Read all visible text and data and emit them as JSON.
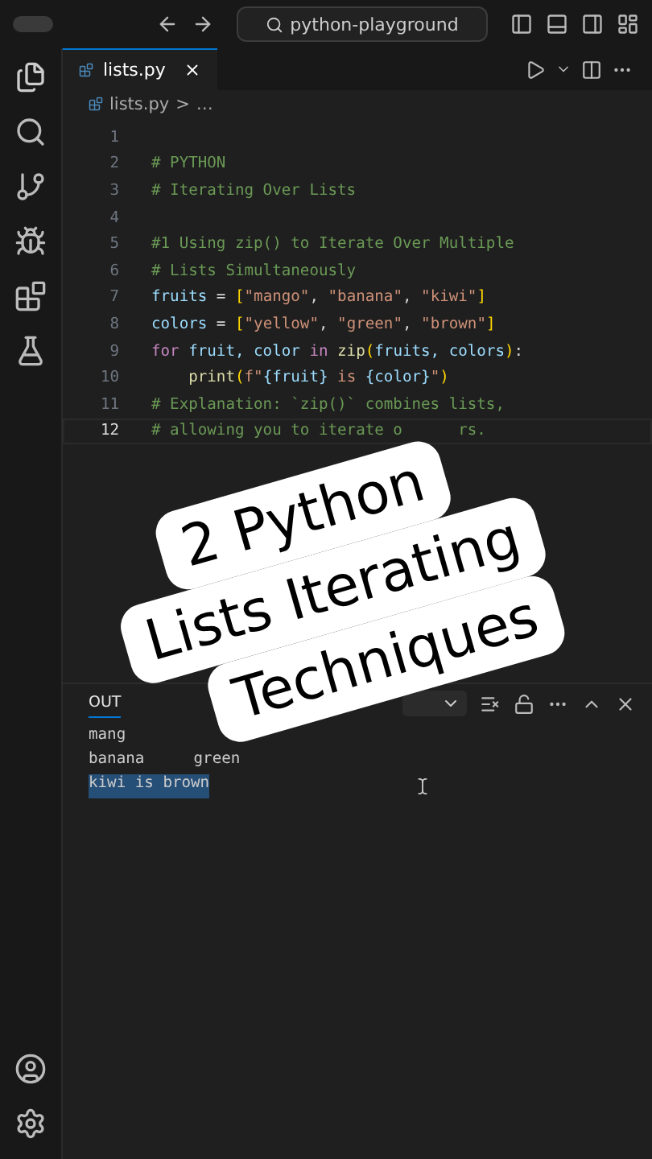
{
  "title_bar": {
    "search": "python-playground"
  },
  "tabs": [
    {
      "label": "lists.py",
      "selected": true
    }
  ],
  "breadcrumb": [
    "lists.py",
    ">",
    "…"
  ],
  "editor": {
    "lines": [
      {
        "number": "1",
        "current": false
      },
      {
        "number": "2",
        "current": false,
        "tokens": [
          {
            "t": "# PYTHON",
            "kind": "comment"
          }
        ]
      },
      {
        "number": "3",
        "current": false,
        "tokens": [
          {
            "t": "# Iterating Over Lists",
            "kind": "comment"
          }
        ]
      },
      {
        "number": "4",
        "current": false
      },
      {
        "number": "5",
        "current": false,
        "tokens": [
          {
            "t": "#1 Using zip() to Iterate Over Multiple",
            "kind": "comment"
          }
        ]
      },
      {
        "number": "6",
        "current": false,
        "tokens": [
          {
            "t": "# Lists Simultaneously",
            "kind": "comment"
          }
        ]
      },
      {
        "number": "7",
        "current": false,
        "tokens": [
          {
            "t": "fruits",
            "kind": "var"
          },
          {
            "t": " = ",
            "kind": "op"
          },
          {
            "t": "[",
            "kind": "bracket"
          },
          {
            "t": "\"mango\"",
            "kind": "str"
          },
          {
            "t": ", ",
            "kind": "op"
          },
          {
            "t": "\"banana\"",
            "kind": "str"
          },
          {
            "t": ", ",
            "kind": "op"
          },
          {
            "t": "\"kiwi\"",
            "kind": "str"
          },
          {
            "t": "]",
            "kind": "bracket"
          }
        ]
      },
      {
        "number": "8",
        "current": false,
        "tokens": [
          {
            "t": "colors",
            "kind": "var"
          },
          {
            "t": " = ",
            "kind": "op"
          },
          {
            "t": "[",
            "kind": "bracket"
          },
          {
            "t": "\"yellow\"",
            "kind": "str"
          },
          {
            "t": ", ",
            "kind": "op"
          },
          {
            "t": "\"green\"",
            "kind": "str"
          },
          {
            "t": ", ",
            "kind": "op"
          },
          {
            "t": "\"brown\"",
            "kind": "str"
          },
          {
            "t": "]",
            "kind": "bracket"
          }
        ]
      },
      {
        "number": "9",
        "current": false,
        "tokens": [
          {
            "t": "for",
            "kind": "kw"
          },
          {
            "t": " fruit, color ",
            "kind": "var"
          },
          {
            "t": "in ",
            "kind": "kw"
          },
          {
            "t": "zip",
            "kind": "fn"
          },
          {
            "t": "(",
            "kind": "bracket"
          },
          {
            "t": "fruits, colors",
            "kind": "var"
          },
          {
            "t": ")",
            "kind": "bracket"
          },
          {
            "t": ":",
            "kind": "op"
          }
        ]
      },
      {
        "number": "10",
        "current": false,
        "indented": true,
        "tokens": [
          {
            "t": "print",
            "kind": "fn"
          },
          {
            "t": "(",
            "kind": "bracket"
          },
          {
            "t": "f\"",
            "kind": "str"
          },
          {
            "t": "{fruit}",
            "kind": "var"
          },
          {
            "t": " is ",
            "kind": "str"
          },
          {
            "t": "{color}",
            "kind": "var"
          },
          {
            "t": "\"",
            "kind": "str"
          },
          {
            "t": ")",
            "kind": "bracket"
          }
        ]
      },
      {
        "number": "11",
        "current": false,
        "tokens": [
          {
            "t": "# Explanation: `zip()` combines lists,",
            "kind": "comment"
          }
        ]
      },
      {
        "number": "12",
        "current": true,
        "tokens": [
          {
            "t": "# allowing you to iterate o",
            "kind": "comment"
          },
          {
            "t": "rs.",
            "kind": "comment",
            "after_gap": true
          }
        ]
      }
    ]
  },
  "panel": {
    "tabs": [
      {
        "label": "OUT",
        "selected": true
      }
    ],
    "output": [
      {
        "parts": [
          "mang"
        ],
        "selected": false
      },
      {
        "parts": [
          "banana",
          "green"
        ],
        "selected": false
      },
      {
        "parts": [
          "kiwi is brown"
        ],
        "selected": true
      }
    ]
  },
  "overlay": {
    "lines": [
      "2 Python",
      "Lists Iterating",
      "Techniques"
    ]
  }
}
